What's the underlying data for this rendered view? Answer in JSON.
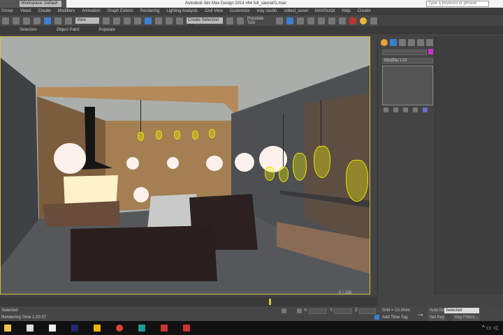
{
  "titlebar": {
    "workspace": "Workspace: Default",
    "title": "Autodesk 3ds Max Design 2014 x64    full_sauna01.max",
    "search_placeholder": "Type a keyword or phrase"
  },
  "menu": [
    "Group",
    "Views",
    "Create",
    "Modifiers",
    "Animation",
    "Graph Editors",
    "Rendering",
    "Lighting Analysis",
    "Civil View",
    "Customize",
    "vray studio",
    "collect_asset",
    "MAXScript",
    "Help",
    "Creatix"
  ],
  "toolbar": {
    "view_dropdown": "View",
    "selection_set": "Create Selection Set",
    "populate": "Populate Tool"
  },
  "ribbon": [
    "Selection",
    "Object Paint",
    "Populate"
  ],
  "command_panel": {
    "modifier_list": "Modifier List"
  },
  "timeline": {
    "frame": "0 / 100"
  },
  "status": {
    "selected": "Selected",
    "render_time": "Rendering Time  1:20:37",
    "x_label": "X:",
    "y_label": "Y:",
    "z_label": "Z:",
    "grid": "Grid = 10,0mm",
    "add_time_tag": "Add Time Tag",
    "auto_key": "Auto Key",
    "key_mode": "Selected",
    "set_key": "Set Key",
    "key_filters": "Key Filters..."
  },
  "colors": {
    "viewport_border": "#d7c23c",
    "accent": "#3a7fd0",
    "object_color": "#cc33cc"
  }
}
